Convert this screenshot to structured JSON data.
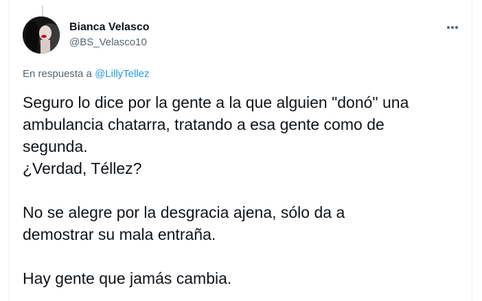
{
  "author": {
    "name": "Bianca Velasco",
    "handle": "@BS_Velasco10",
    "avatar_icon": "profile-photo"
  },
  "menu": {
    "icon": "more-horizontal-icon"
  },
  "reply": {
    "prefix": "En respuesta a",
    "mention": "@LillyTellez"
  },
  "tweet": {
    "lines": [
      "Seguro lo dice por la gente a la que alguien \"donó\" una",
      "ambulancia chatarra, tratando a esa gente como de",
      "segunda.",
      "¿Verdad, Téllez?",
      "",
      "No se alegre por la desgracia ajena, sólo da a",
      "demostrar su mala entraña.",
      "",
      "Hay gente que jamás cambia."
    ]
  },
  "colors": {
    "text": "#0f1419",
    "secondary": "#536471",
    "link": "#1d9bf0",
    "border": "#eff3f4"
  }
}
